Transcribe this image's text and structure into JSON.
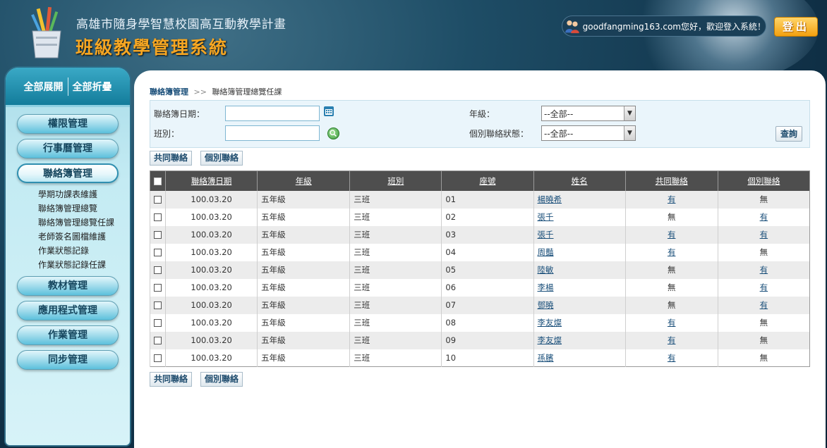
{
  "header": {
    "site_title": "高雄市隨身學智慧校園高互動教學計畫",
    "system_title": "班級教學管理系統",
    "welcome": "goodfangming163.com您好，歡迎登入系統！",
    "logout_label": "登出"
  },
  "sidebar": {
    "expand_all": "全部展開",
    "collapse_all": "全部折疊",
    "menu": [
      {
        "label": "權限管理"
      },
      {
        "label": "行事曆管理"
      },
      {
        "label": "聯絡簿管理"
      },
      {
        "label": "教材管理"
      },
      {
        "label": "應用程式管理"
      },
      {
        "label": "作業管理"
      },
      {
        "label": "同步管理"
      }
    ],
    "submenu": [
      "學期功課表維護",
      "聯絡簿管理總覽",
      "聯絡簿管理總覽任課",
      "老師簽名圖檔維護",
      "作業狀態記錄",
      "作業狀態記錄任課"
    ]
  },
  "breadcrumb": {
    "parent": "聯絡簿管理",
    "separator": ">>",
    "current": "聯絡簿管理總覽任課"
  },
  "search": {
    "date_label": "聯絡簿日期：",
    "date_value": "",
    "class_label": "班別：",
    "class_value": "",
    "grade_label": "年級：",
    "grade_value": "--全部--",
    "status_label": "個別聯絡狀態：",
    "status_value": "--全部--",
    "query_label": "查詢"
  },
  "actions": {
    "common_label": "共同聯絡",
    "individual_label": "個別聯絡"
  },
  "table": {
    "columns": [
      "聯絡簿日期",
      "年級",
      "班別",
      "座號",
      "姓名",
      "共同聯絡",
      "個別聯絡"
    ],
    "rows": [
      {
        "date": "100.03.20",
        "grade": "五年級",
        "class": "三班",
        "seat": "01",
        "name": "楊曉希",
        "common": "有",
        "individual": "無"
      },
      {
        "date": "100.03.20",
        "grade": "五年級",
        "class": "三班",
        "seat": "02",
        "name": "張千",
        "common": "無",
        "individual": "有"
      },
      {
        "date": "100.03.20",
        "grade": "五年級",
        "class": "三班",
        "seat": "03",
        "name": "張千",
        "common": "有",
        "individual": "有"
      },
      {
        "date": "100.03.20",
        "grade": "五年級",
        "class": "三班",
        "seat": "04",
        "name": "周豔",
        "common": "有",
        "individual": "無"
      },
      {
        "date": "100.03.20",
        "grade": "五年級",
        "class": "三班",
        "seat": "05",
        "name": "陸敏",
        "common": "無",
        "individual": "有"
      },
      {
        "date": "100.03.20",
        "grade": "五年級",
        "class": "三班",
        "seat": "06",
        "name": "李楊",
        "common": "無",
        "individual": "有"
      },
      {
        "date": "100.03.20",
        "grade": "五年級",
        "class": "三班",
        "seat": "07",
        "name": "鄧曉",
        "common": "無",
        "individual": "有"
      },
      {
        "date": "100.03.20",
        "grade": "五年級",
        "class": "三班",
        "seat": "08",
        "name": "李友燦",
        "common": "有",
        "individual": "無"
      },
      {
        "date": "100.03.20",
        "grade": "五年級",
        "class": "三班",
        "seat": "09",
        "name": "李友燦",
        "common": "有",
        "individual": "無"
      },
      {
        "date": "100.03.20",
        "grade": "五年級",
        "class": "三班",
        "seat": "10",
        "name": "孫臏",
        "common": "有",
        "individual": "無"
      }
    ]
  },
  "colors": {
    "accent_orange": "#f5a623",
    "header_dark": "#0f2f45",
    "table_header": "#4e4e4e",
    "link": "#1a4f7a"
  }
}
